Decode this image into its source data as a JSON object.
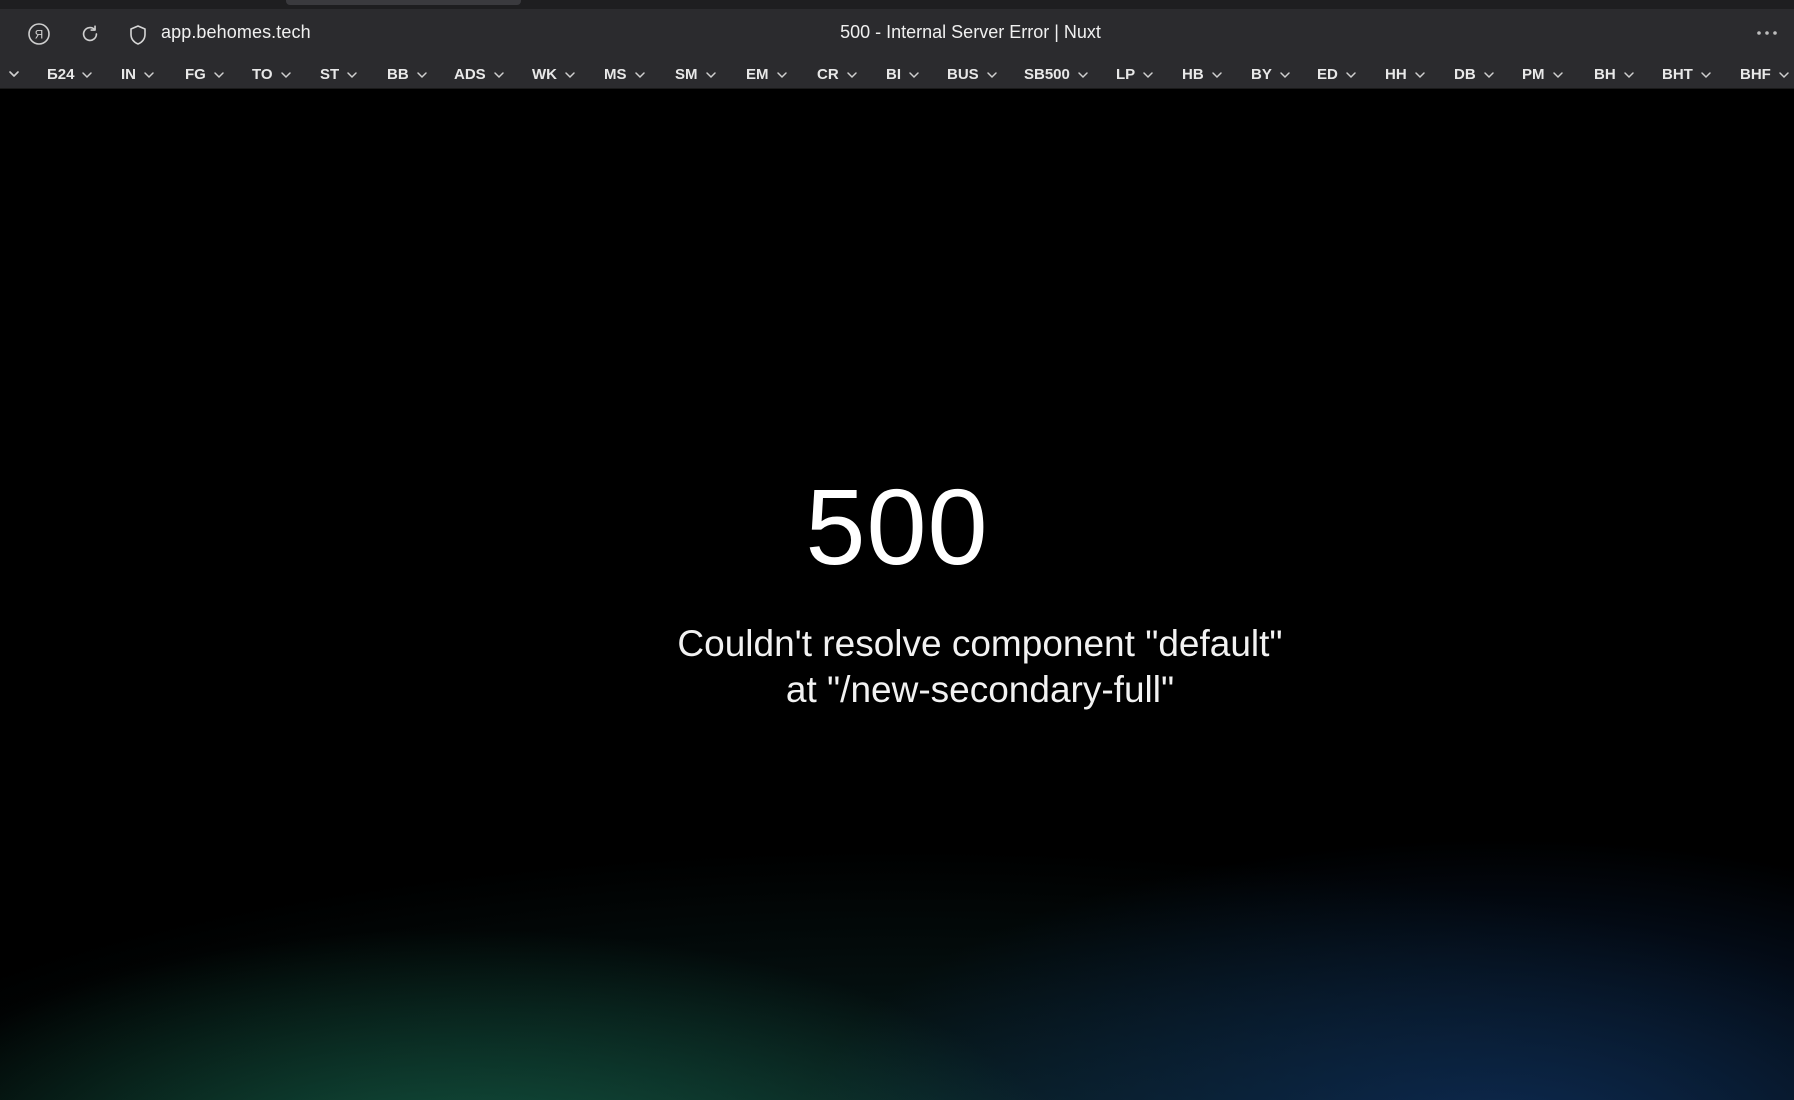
{
  "browser": {
    "url": "app.behomes.tech",
    "title": "500 - Internal Server Error | Nuxt"
  },
  "bookmarks": [
    {
      "label": "Б24"
    },
    {
      "label": "IN"
    },
    {
      "label": "FG"
    },
    {
      "label": "TO"
    },
    {
      "label": "ST"
    },
    {
      "label": "BB"
    },
    {
      "label": "ADS"
    },
    {
      "label": "WK"
    },
    {
      "label": "MS"
    },
    {
      "label": "SM"
    },
    {
      "label": "EM"
    },
    {
      "label": "CR"
    },
    {
      "label": "BI"
    },
    {
      "label": "BUS"
    },
    {
      "label": "SB500"
    },
    {
      "label": "LP"
    },
    {
      "label": "HB"
    },
    {
      "label": "BY"
    },
    {
      "label": "ED"
    },
    {
      "label": "HH"
    },
    {
      "label": "DB"
    },
    {
      "label": "PM"
    },
    {
      "label": "BH"
    },
    {
      "label": "BHT"
    },
    {
      "label": "BHF"
    }
  ],
  "error": {
    "code": "500",
    "message": "Couldn't resolve component \"default\" at \"/new-secondary-full\""
  }
}
